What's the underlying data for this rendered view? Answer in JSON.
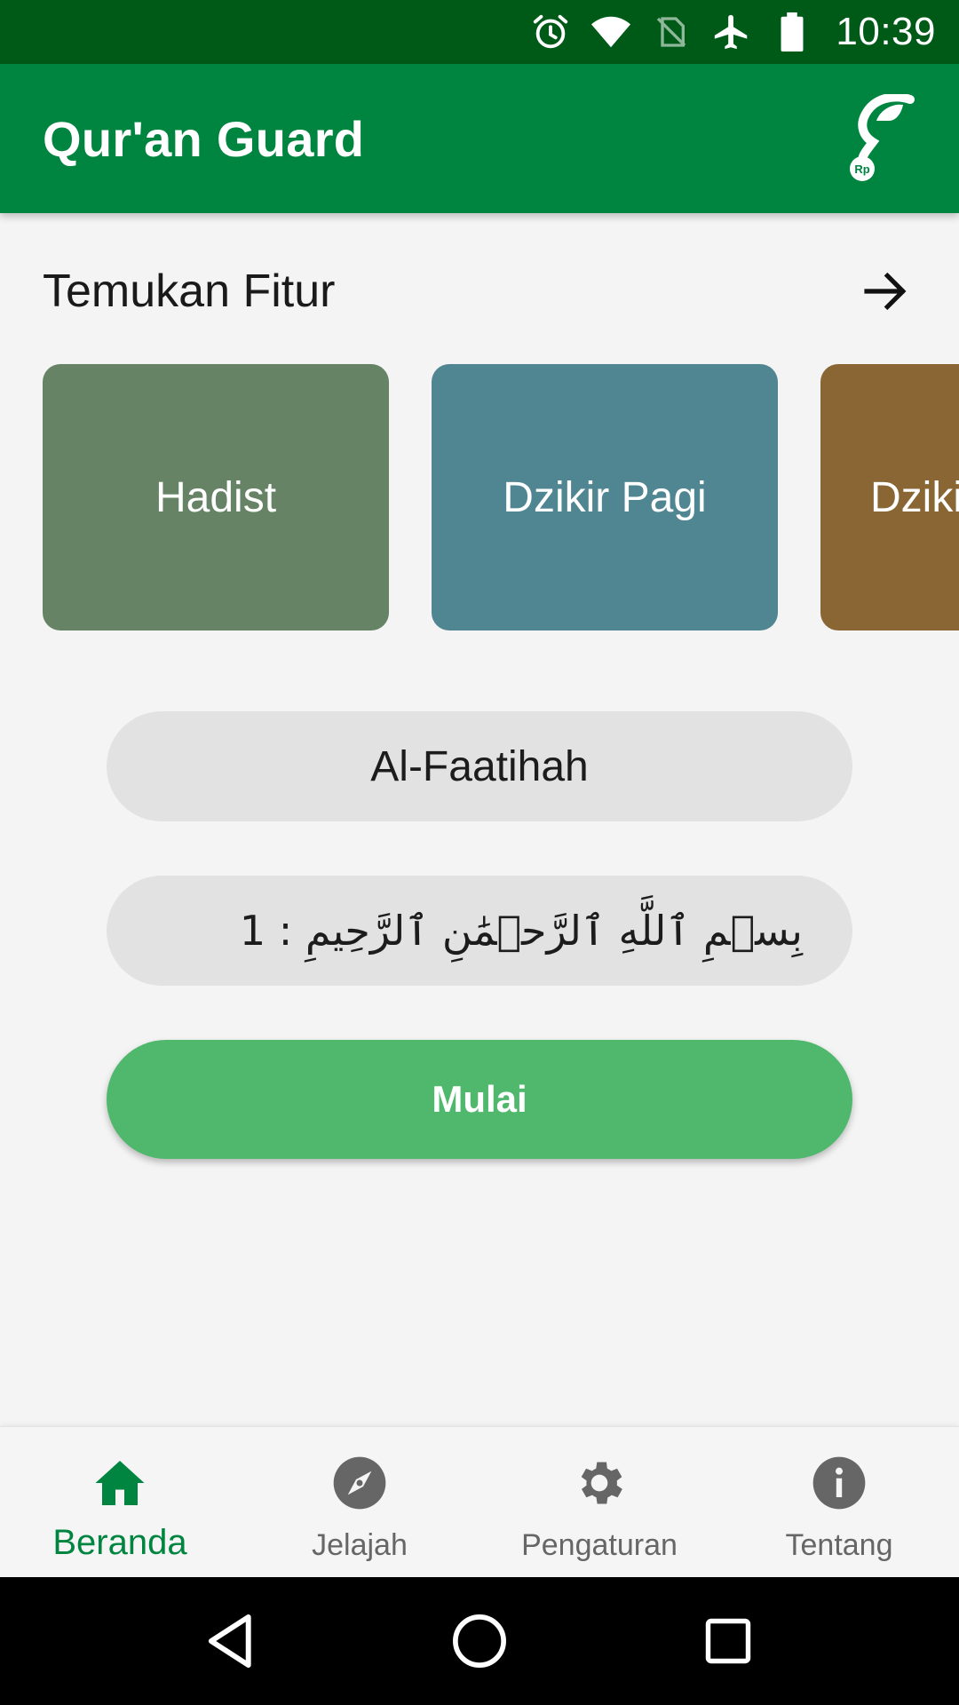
{
  "status_bar": {
    "time": "10:39",
    "icons": [
      "alarm-icon",
      "wifi-icon",
      "no-sim-icon",
      "airplane-mode-icon",
      "battery-icon"
    ]
  },
  "app_bar": {
    "title": "Qur'an Guard",
    "donate_icon": "donate-hand-icon",
    "donate_icon_text": "Rp"
  },
  "features": {
    "title": "Temukan Fitur",
    "see_all_icon": "arrow-right-icon",
    "cards": [
      {
        "label": "Hadist",
        "color": "#678366"
      },
      {
        "label": "Dzikir Pagi",
        "color": "#508691"
      },
      {
        "label": "Dzikir",
        "color": "#8a6634"
      }
    ]
  },
  "selector": {
    "surah": "Al-Faatihah",
    "ayah": "1 : بِسۡمِ ٱللَّهِ ٱلرَّحۡمَٰنِ ٱلرَّحِيمِ"
  },
  "start_button": {
    "label": "Mulai"
  },
  "bottom_nav": {
    "items": [
      {
        "label": "Beranda",
        "icon": "home-icon",
        "active": true
      },
      {
        "label": "Jelajah",
        "icon": "compass-icon",
        "active": false
      },
      {
        "label": "Pengaturan",
        "icon": "gear-icon",
        "active": false
      },
      {
        "label": "Tentang",
        "icon": "info-icon",
        "active": false
      }
    ]
  },
  "colors": {
    "status_bar": "#005a17",
    "primary": "#008540",
    "start_button": "#4fb86c",
    "pill": "#e2e2e2",
    "nav_inactive": "#666666"
  }
}
